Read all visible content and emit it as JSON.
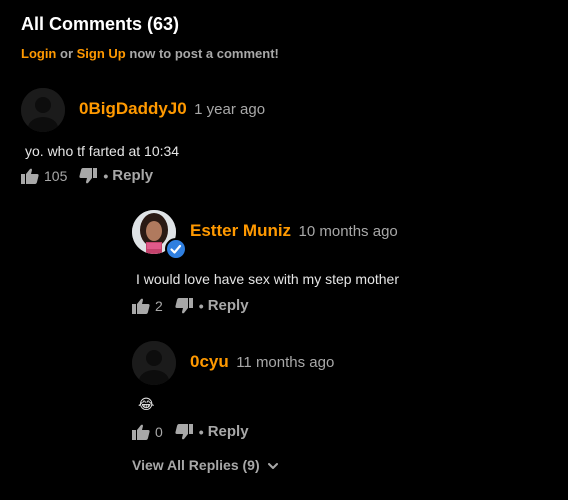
{
  "header": {
    "title": "All Comments (63)",
    "login_label": "Login",
    "or_text": "or",
    "signup_label": "Sign Up",
    "post_prompt": "now to post a comment!"
  },
  "comments": [
    {
      "author": "0BigDaddyJ0",
      "time": "1 year ago",
      "text": "yo. who tf farted at 10:34",
      "likes": "105",
      "reply_label": "Reply",
      "avatar": "default-avatar"
    },
    {
      "author": "Estter Muniz",
      "time": "10 months ago",
      "text": "I would love have sex with my step mother",
      "likes": "2",
      "reply_label": "Reply",
      "avatar": "profile-photo",
      "verified": true
    },
    {
      "author": "0cyu",
      "time": "11 months ago",
      "text": "😂",
      "likes": "0",
      "reply_label": "Reply",
      "avatar": "default-avatar"
    }
  ],
  "view_replies_label": "View All Replies (9)",
  "icons": {
    "like": "thumbs-up-icon",
    "dislike": "thumbs-down-icon",
    "verified": "checkmark-badge-icon",
    "expand": "chevron-down-icon"
  },
  "colors": {
    "background": "#000000",
    "accent": "#ff9900",
    "muted": "#a8a8a8",
    "text": "#e6e6e6",
    "verified": "#2f7fe0"
  },
  "dot_separator": "•"
}
